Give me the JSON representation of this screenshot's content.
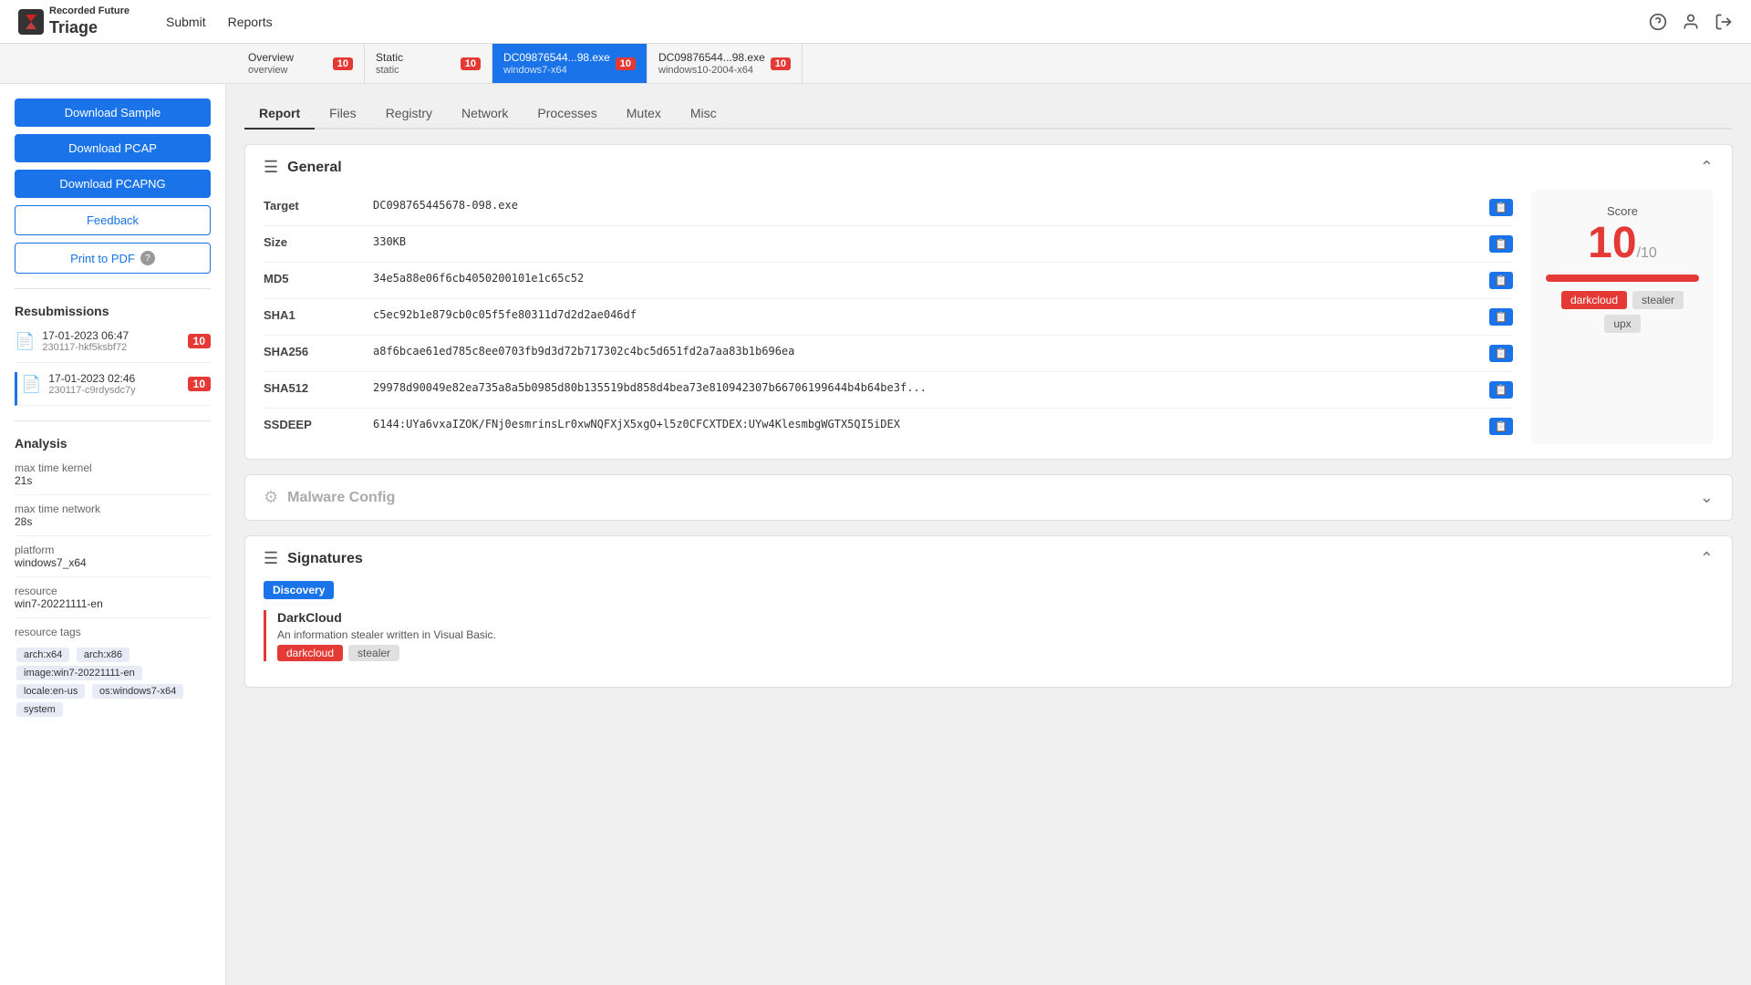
{
  "nav": {
    "brand_small": "Recorded Future",
    "brand_large": "Triage",
    "links": [
      "Submit",
      "Reports"
    ],
    "icons": [
      "help",
      "user",
      "logout"
    ]
  },
  "tabs": [
    {
      "id": "overview",
      "label": "Overview",
      "sublabel": "overview",
      "badge": "10",
      "active": false
    },
    {
      "id": "static",
      "label": "Static",
      "sublabel": "static",
      "badge": "10",
      "active": false
    },
    {
      "id": "dc98_w7",
      "label": "DC09876544...98.exe",
      "sublabel": "windows7-x64",
      "badge": "10",
      "active": true
    },
    {
      "id": "dc98_w10",
      "label": "DC09876544...98.exe",
      "sublabel": "windows10-2004-x64",
      "badge": "10",
      "active": false
    }
  ],
  "sidebar": {
    "buttons": [
      {
        "id": "download-sample",
        "label": "Download Sample",
        "style": "primary"
      },
      {
        "id": "download-pcap",
        "label": "Download PCAP",
        "style": "primary"
      },
      {
        "id": "download-pcapng",
        "label": "Download PCAPNG",
        "style": "primary"
      },
      {
        "id": "feedback",
        "label": "Feedback",
        "style": "outline"
      },
      {
        "id": "print-pdf",
        "label": "Print to PDF",
        "style": "print"
      }
    ],
    "resubmissions_title": "Resubmissions",
    "resubmissions": [
      {
        "date": "17-01-2023 06:47",
        "id": "230117-hkf5ksbf72",
        "badge": "10",
        "active": false
      },
      {
        "date": "17-01-2023 02:46",
        "id": "230117-c9rdysdc7y",
        "badge": "10",
        "active": true
      }
    ],
    "analysis_title": "Analysis",
    "analysis": [
      {
        "label": "max time kernel",
        "value": "21s"
      },
      {
        "label": "max time network",
        "value": "28s"
      },
      {
        "label": "platform",
        "value": "windows7_x64"
      },
      {
        "label": "resource",
        "value": "win7-20221111-en"
      },
      {
        "label": "resource tags",
        "value": ""
      }
    ],
    "resource_tags": [
      "arch:x64",
      "arch:x86",
      "image:win7-20221111-en",
      "locale:en-us",
      "os:windows7-x64",
      "system"
    ]
  },
  "subtabs": [
    "Report",
    "Files",
    "Registry",
    "Network",
    "Processes",
    "Mutex",
    "Misc"
  ],
  "active_subtab": "Report",
  "general": {
    "title": "General",
    "fields": [
      {
        "key": "Target",
        "value": "DC098765445678-098.exe"
      },
      {
        "key": "Size",
        "value": "330KB"
      },
      {
        "key": "MD5",
        "value": "34e5a88e06f6cb4050200101e1c65c52"
      },
      {
        "key": "SHA1",
        "value": "c5ec92b1e879cb0c05f5fe80311d7d2d2ae046df"
      },
      {
        "key": "SHA256",
        "value": "a8f6bcae61ed785c8ee0703fb9d3d72b717302c4bc5d651fd2a7aa83b1b696ea"
      },
      {
        "key": "SHA512",
        "value": "29978d90049e82ea735a8a5b0985d80b135519bd858d4bea73e810942307b66706199644b4b64be3f..."
      },
      {
        "key": "SSDEEP",
        "value": "6144:UYa6vxaIZOK/FNj0esmrinsLr0xwNQFXjX5xgO+l5z0CFCXTDEX:UYw4KlesmbgWGTX5QI5iDEX"
      }
    ],
    "score": {
      "label": "Score",
      "value": "10",
      "denom": "/10",
      "tags": [
        {
          "label": "darkcloud",
          "style": "red"
        },
        {
          "label": "stealer",
          "style": "gray"
        },
        {
          "label": "upx",
          "style": "gray"
        }
      ]
    }
  },
  "malware_config": {
    "title": "Malware Config",
    "collapsed": true
  },
  "signatures": {
    "title": "Signatures",
    "active_filter": "Discovery",
    "items": [
      {
        "name": "DarkCloud",
        "description": "An information stealer written in Visual Basic.",
        "tags": [
          {
            "label": "darkcloud",
            "style": "red"
          },
          {
            "label": "stealer",
            "style": "gray"
          }
        ]
      }
    ]
  }
}
